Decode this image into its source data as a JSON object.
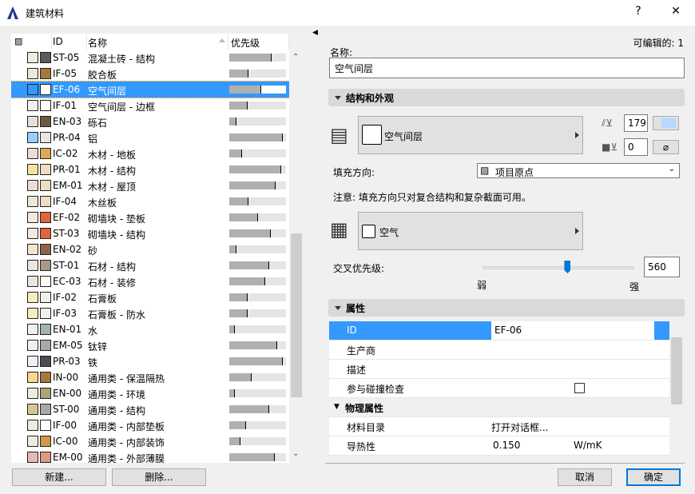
{
  "window": {
    "title": "建筑材料",
    "help": "?",
    "close": "✕"
  },
  "list": {
    "headers": {
      "id": "ID",
      "name": "名称",
      "priority": "优先级"
    },
    "rows": [
      {
        "id": "ST-05",
        "name": "混凝土砖 - 结构",
        "priority": 0.75,
        "fill": "#e8f0e0",
        "color": "#5a5a5a"
      },
      {
        "id": "IF-05",
        "name": "胶合板",
        "priority": 0.34,
        "fill": "#ece8d8",
        "color": "#a87838"
      },
      {
        "id": "EF-06",
        "name": "空气间层",
        "priority": 0.56,
        "fill": "#3399ff",
        "color": "#ffffff"
      },
      {
        "id": "IF-01",
        "name": "空气间层 - 边框",
        "priority": 0.32,
        "fill": "#f0f0f0",
        "color": "#ffffff"
      },
      {
        "id": "EN-03",
        "name": "砾石",
        "priority": 0.13,
        "fill": "#e8e0d8",
        "color": "#6e5a40"
      },
      {
        "id": "PR-04",
        "name": "铝",
        "priority": 0.94,
        "fill": "#99ccff",
        "color": "#eae4e4"
      },
      {
        "id": "IC-02",
        "name": "木材 - 地板",
        "priority": 0.22,
        "fill": "#ecdcd4",
        "color": "#e0a850"
      },
      {
        "id": "PR-01",
        "name": "木材 - 结构",
        "priority": 0.91,
        "fill": "#f8e0a0",
        "color": "#f0dcc0"
      },
      {
        "id": "EM-01",
        "name": "木材 - 屋顶",
        "priority": 0.81,
        "fill": "#ecdcd4",
        "color": "#f0dcc0"
      },
      {
        "id": "IF-04",
        "name": "木丝板",
        "priority": 0.34,
        "fill": "#ece8d8",
        "color": "#f0dcc0"
      },
      {
        "id": "EF-02",
        "name": "砌墙块 - 垫板",
        "priority": 0.51,
        "fill": "#f4e8e0",
        "color": "#e0643c"
      },
      {
        "id": "ST-03",
        "name": "砌墙块 - 结构",
        "priority": 0.73,
        "fill": "#f4e8e0",
        "color": "#e0643c"
      },
      {
        "id": "EN-02",
        "name": "砂",
        "priority": 0.12,
        "fill": "#f4e4cc",
        "color": "#8e6448"
      },
      {
        "id": "ST-01",
        "name": "石材 - 结构",
        "priority": 0.71,
        "fill": "#ece4e0",
        "color": "#a89888"
      },
      {
        "id": "EC-03",
        "name": "石材 - 装修",
        "priority": 0.63,
        "fill": "#ece4e0",
        "color": "#fcfcec"
      },
      {
        "id": "IF-02",
        "name": "石膏板",
        "priority": 0.32,
        "fill": "#f8ecc0",
        "color": "#eef2ea"
      },
      {
        "id": "IF-03",
        "name": "石膏板 - 防水",
        "priority": 0.33,
        "fill": "#f8ecc0",
        "color": "#eef2ea"
      },
      {
        "id": "EN-01",
        "name": "水",
        "priority": 0.1,
        "fill": "#f0f0f0",
        "color": "#a0b4b0"
      },
      {
        "id": "EM-05",
        "name": "钛锌",
        "priority": 0.85,
        "fill": "#f0f0f0",
        "color": "#a8a8ac"
      },
      {
        "id": "PR-03",
        "name": "铁",
        "priority": 0.94,
        "fill": "#f0f0f0",
        "color": "#4a4c54"
      },
      {
        "id": "IN-00",
        "name": "通用类 - 保温隔热",
        "priority": 0.4,
        "fill": "#f8d890",
        "color": "#a87838"
      },
      {
        "id": "EN-00",
        "name": "通用类 - 环境",
        "priority": 0.1,
        "fill": "#f0ece0",
        "color": "#aca478"
      },
      {
        "id": "ST-00",
        "name": "通用类 - 结构",
        "priority": 0.7,
        "fill": "#d8c890",
        "color": "#a8a8a8"
      },
      {
        "id": "IF-00",
        "name": "通用类 - 内部垫板",
        "priority": 0.3,
        "fill": "#f0ece0",
        "color": "#ffffff"
      },
      {
        "id": "IC-00",
        "name": "通用类 - 内部装饰",
        "priority": 0.2,
        "fill": "#f0ece0",
        "color": "#d09848"
      },
      {
        "id": "EM-00",
        "name": "通用类 - 外部薄膜",
        "priority": 0.8,
        "fill": "#e8b8b8",
        "color": "#e09884"
      }
    ]
  },
  "buttons": {
    "new": "新建...",
    "delete": "删除...",
    "cancel": "取消",
    "ok": "确定"
  },
  "detail": {
    "editable": "可编辑的: 1",
    "name_label": "名称:",
    "name_value": "空气间层",
    "section_structure": "结构和外观",
    "surface_name": "空气间层",
    "pen_value": "179",
    "bg_pen_value": "0",
    "no_pen": "⌀",
    "fill_dir_label": "填充方向:",
    "fill_dir_value": "项目原点",
    "note": "注意: 填充方向只对复合结构和复杂截面可用。",
    "cut_fill_name": "空气",
    "priority_label": "交叉优先级:",
    "priority_value": "560",
    "priority_fraction": 0.56,
    "weak": "弱",
    "strong": "强",
    "section_props": "属性",
    "props": {
      "id_label": "ID",
      "id_value": "EF-06",
      "maker": "生产商",
      "desc": "描述",
      "collision": "参与碰撞检查",
      "physical": "物理属性",
      "catalog": "材料目录",
      "catalog_value": "打开对话框...",
      "thermal": "导热性",
      "thermal_value": "0.150",
      "thermal_unit": "W/mK"
    }
  },
  "colors": {
    "selection": "#3399ff",
    "slider": "#0078d7"
  }
}
